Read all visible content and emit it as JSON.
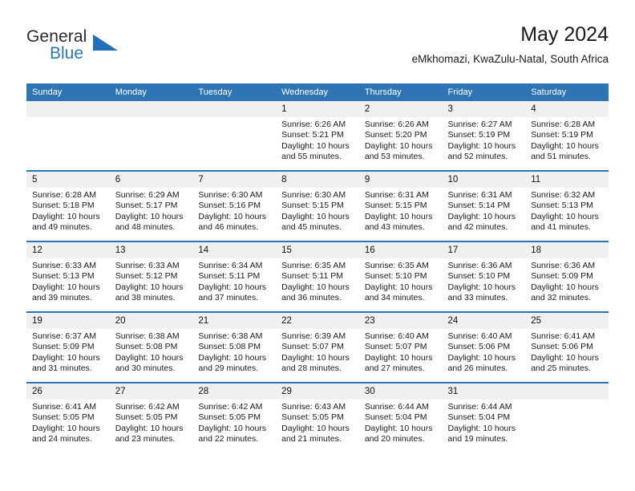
{
  "brand": {
    "name_top": "General",
    "name_bottom": "Blue",
    "triangle_color": "#2470b8",
    "blue_color": "#2e75b6"
  },
  "header": {
    "title": "May 2024",
    "subtitle": "eMkhomazi, KwaZulu-Natal, South Africa"
  },
  "theme": {
    "header_blue": "#2e75b6",
    "daynum_gray": "#f0f0f0"
  },
  "weekday_headers": [
    "Sunday",
    "Monday",
    "Tuesday",
    "Wednesday",
    "Thursday",
    "Friday",
    "Saturday"
  ],
  "weeks": [
    [
      {
        "day": "",
        "sunrise": "",
        "sunset": "",
        "daylight_1": "",
        "daylight_2": ""
      },
      {
        "day": "",
        "sunrise": "",
        "sunset": "",
        "daylight_1": "",
        "daylight_2": ""
      },
      {
        "day": "",
        "sunrise": "",
        "sunset": "",
        "daylight_1": "",
        "daylight_2": ""
      },
      {
        "day": "1",
        "sunrise": "Sunrise: 6:26 AM",
        "sunset": "Sunset: 5:21 PM",
        "daylight_1": "Daylight: 10 hours",
        "daylight_2": "and 55 minutes."
      },
      {
        "day": "2",
        "sunrise": "Sunrise: 6:26 AM",
        "sunset": "Sunset: 5:20 PM",
        "daylight_1": "Daylight: 10 hours",
        "daylight_2": "and 53 minutes."
      },
      {
        "day": "3",
        "sunrise": "Sunrise: 6:27 AM",
        "sunset": "Sunset: 5:19 PM",
        "daylight_1": "Daylight: 10 hours",
        "daylight_2": "and 52 minutes."
      },
      {
        "day": "4",
        "sunrise": "Sunrise: 6:28 AM",
        "sunset": "Sunset: 5:19 PM",
        "daylight_1": "Daylight: 10 hours",
        "daylight_2": "and 51 minutes."
      }
    ],
    [
      {
        "day": "5",
        "sunrise": "Sunrise: 6:28 AM",
        "sunset": "Sunset: 5:18 PM",
        "daylight_1": "Daylight: 10 hours",
        "daylight_2": "and 49 minutes."
      },
      {
        "day": "6",
        "sunrise": "Sunrise: 6:29 AM",
        "sunset": "Sunset: 5:17 PM",
        "daylight_1": "Daylight: 10 hours",
        "daylight_2": "and 48 minutes."
      },
      {
        "day": "7",
        "sunrise": "Sunrise: 6:30 AM",
        "sunset": "Sunset: 5:16 PM",
        "daylight_1": "Daylight: 10 hours",
        "daylight_2": "and 46 minutes."
      },
      {
        "day": "8",
        "sunrise": "Sunrise: 6:30 AM",
        "sunset": "Sunset: 5:15 PM",
        "daylight_1": "Daylight: 10 hours",
        "daylight_2": "and 45 minutes."
      },
      {
        "day": "9",
        "sunrise": "Sunrise: 6:31 AM",
        "sunset": "Sunset: 5:15 PM",
        "daylight_1": "Daylight: 10 hours",
        "daylight_2": "and 43 minutes."
      },
      {
        "day": "10",
        "sunrise": "Sunrise: 6:31 AM",
        "sunset": "Sunset: 5:14 PM",
        "daylight_1": "Daylight: 10 hours",
        "daylight_2": "and 42 minutes."
      },
      {
        "day": "11",
        "sunrise": "Sunrise: 6:32 AM",
        "sunset": "Sunset: 5:13 PM",
        "daylight_1": "Daylight: 10 hours",
        "daylight_2": "and 41 minutes."
      }
    ],
    [
      {
        "day": "12",
        "sunrise": "Sunrise: 6:33 AM",
        "sunset": "Sunset: 5:13 PM",
        "daylight_1": "Daylight: 10 hours",
        "daylight_2": "and 39 minutes."
      },
      {
        "day": "13",
        "sunrise": "Sunrise: 6:33 AM",
        "sunset": "Sunset: 5:12 PM",
        "daylight_1": "Daylight: 10 hours",
        "daylight_2": "and 38 minutes."
      },
      {
        "day": "14",
        "sunrise": "Sunrise: 6:34 AM",
        "sunset": "Sunset: 5:11 PM",
        "daylight_1": "Daylight: 10 hours",
        "daylight_2": "and 37 minutes."
      },
      {
        "day": "15",
        "sunrise": "Sunrise: 6:35 AM",
        "sunset": "Sunset: 5:11 PM",
        "daylight_1": "Daylight: 10 hours",
        "daylight_2": "and 36 minutes."
      },
      {
        "day": "16",
        "sunrise": "Sunrise: 6:35 AM",
        "sunset": "Sunset: 5:10 PM",
        "daylight_1": "Daylight: 10 hours",
        "daylight_2": "and 34 minutes."
      },
      {
        "day": "17",
        "sunrise": "Sunrise: 6:36 AM",
        "sunset": "Sunset: 5:10 PM",
        "daylight_1": "Daylight: 10 hours",
        "daylight_2": "and 33 minutes."
      },
      {
        "day": "18",
        "sunrise": "Sunrise: 6:36 AM",
        "sunset": "Sunset: 5:09 PM",
        "daylight_1": "Daylight: 10 hours",
        "daylight_2": "and 32 minutes."
      }
    ],
    [
      {
        "day": "19",
        "sunrise": "Sunrise: 6:37 AM",
        "sunset": "Sunset: 5:09 PM",
        "daylight_1": "Daylight: 10 hours",
        "daylight_2": "and 31 minutes."
      },
      {
        "day": "20",
        "sunrise": "Sunrise: 6:38 AM",
        "sunset": "Sunset: 5:08 PM",
        "daylight_1": "Daylight: 10 hours",
        "daylight_2": "and 30 minutes."
      },
      {
        "day": "21",
        "sunrise": "Sunrise: 6:38 AM",
        "sunset": "Sunset: 5:08 PM",
        "daylight_1": "Daylight: 10 hours",
        "daylight_2": "and 29 minutes."
      },
      {
        "day": "22",
        "sunrise": "Sunrise: 6:39 AM",
        "sunset": "Sunset: 5:07 PM",
        "daylight_1": "Daylight: 10 hours",
        "daylight_2": "and 28 minutes."
      },
      {
        "day": "23",
        "sunrise": "Sunrise: 6:40 AM",
        "sunset": "Sunset: 5:07 PM",
        "daylight_1": "Daylight: 10 hours",
        "daylight_2": "and 27 minutes."
      },
      {
        "day": "24",
        "sunrise": "Sunrise: 6:40 AM",
        "sunset": "Sunset: 5:06 PM",
        "daylight_1": "Daylight: 10 hours",
        "daylight_2": "and 26 minutes."
      },
      {
        "day": "25",
        "sunrise": "Sunrise: 6:41 AM",
        "sunset": "Sunset: 5:06 PM",
        "daylight_1": "Daylight: 10 hours",
        "daylight_2": "and 25 minutes."
      }
    ],
    [
      {
        "day": "26",
        "sunrise": "Sunrise: 6:41 AM",
        "sunset": "Sunset: 5:05 PM",
        "daylight_1": "Daylight: 10 hours",
        "daylight_2": "and 24 minutes."
      },
      {
        "day": "27",
        "sunrise": "Sunrise: 6:42 AM",
        "sunset": "Sunset: 5:05 PM",
        "daylight_1": "Daylight: 10 hours",
        "daylight_2": "and 23 minutes."
      },
      {
        "day": "28",
        "sunrise": "Sunrise: 6:42 AM",
        "sunset": "Sunset: 5:05 PM",
        "daylight_1": "Daylight: 10 hours",
        "daylight_2": "and 22 minutes."
      },
      {
        "day": "29",
        "sunrise": "Sunrise: 6:43 AM",
        "sunset": "Sunset: 5:05 PM",
        "daylight_1": "Daylight: 10 hours",
        "daylight_2": "and 21 minutes."
      },
      {
        "day": "30",
        "sunrise": "Sunrise: 6:44 AM",
        "sunset": "Sunset: 5:04 PM",
        "daylight_1": "Daylight: 10 hours",
        "daylight_2": "and 20 minutes."
      },
      {
        "day": "31",
        "sunrise": "Sunrise: 6:44 AM",
        "sunset": "Sunset: 5:04 PM",
        "daylight_1": "Daylight: 10 hours",
        "daylight_2": "and 19 minutes."
      },
      {
        "day": "",
        "sunrise": "",
        "sunset": "",
        "daylight_1": "",
        "daylight_2": ""
      }
    ]
  ]
}
